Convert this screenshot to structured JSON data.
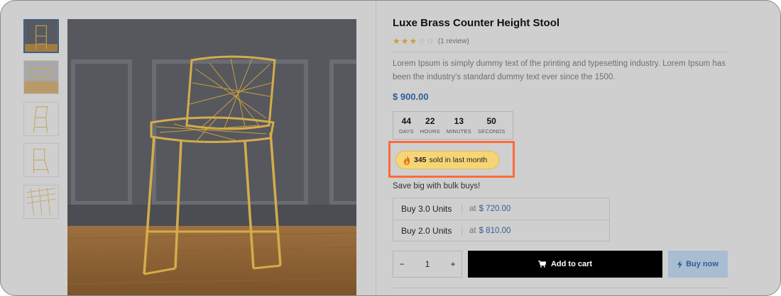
{
  "product": {
    "title": "Luxe Brass Counter Height Stool",
    "rating": 3,
    "rating_max": 5,
    "review_count": "(1 review)",
    "description": "Lorem Ipsum is simply dummy text of the printing and typesetting industry. Lorem Ipsum has been the industry's standard dummy text ever since the 1500.",
    "price": "$ 900.00"
  },
  "countdown": [
    {
      "value": "44",
      "label": "DAYS"
    },
    {
      "value": "22",
      "label": "HOURS"
    },
    {
      "value": "13",
      "label": "MINUTES"
    },
    {
      "value": "50",
      "label": "SECONDS"
    }
  ],
  "sold": {
    "count": "345",
    "text": "sold in last month"
  },
  "bulk": {
    "heading": "Save big with bulk buys!",
    "options": [
      {
        "units": "Buy 3.0 Units",
        "at": "at",
        "price": "$ 720.00"
      },
      {
        "units": "Buy 2.0 Units",
        "at": "at",
        "price": "$ 810.00"
      }
    ]
  },
  "cart": {
    "minus": "−",
    "quantity": "1",
    "plus": "+",
    "add_label": "Add to cart",
    "buy_label": "Buy now"
  },
  "colors": {
    "accent_blue": "#2f5f95",
    "highlight": "#ff6a3c",
    "sold_pill": "#f5d575",
    "star": "#c7a13a"
  },
  "icons": [
    "star-icon",
    "fire-icon",
    "cart-icon",
    "bolt-icon"
  ]
}
